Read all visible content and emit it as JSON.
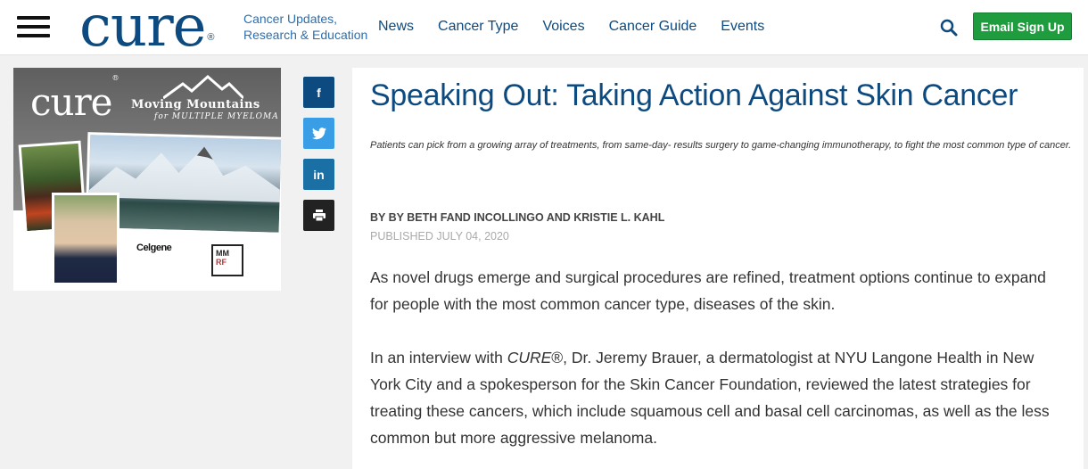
{
  "header": {
    "logo": "cure",
    "logo_mark": "®",
    "tagline_line1": "Cancer Updates,",
    "tagline_line2": "Research & Education",
    "nav": [
      "News",
      "Cancer Type",
      "Voices",
      "Cancer Guide",
      "Events"
    ],
    "signup_label": "Email Sign Up",
    "icons": [
      "hamburger-menu-icon",
      "search-icon"
    ]
  },
  "ad": {
    "logo": "cure",
    "logo_mark": "®",
    "headline": "Moving Mountains",
    "subheadline": "for MULTIPLE MYELOMA",
    "sponsor1": "Celgene",
    "sponsor2_line1": "MM",
    "sponsor2_line2": "RF"
  },
  "social": {
    "facebook": "f",
    "twitter": "t",
    "linkedin": "in",
    "print_icon": "print-icon"
  },
  "article": {
    "title": "Speaking Out: Taking Action Against Skin Cancer",
    "deck": "Patients can pick from a growing array of treatments, from same-day- results surgery to game-changing immunotherapy, to fight the most common type of cancer.",
    "byline": "BY BY BETH FAND INCOLLINGO AND KRISTIE L. KAHL",
    "published": "PUBLISHED JULY 04, 2020",
    "p1": "As novel drugs emerge and surgical procedures are refined, treatment options continue to expand for people with the most common cancer type, diseases of the skin.",
    "p2_before": "In an interview with ",
    "p2_em": "CURE",
    "p2_after": "®, Dr. Jeremy Brauer, a dermatologist at NYU Langone Health in New York City and a spokesperson for the Skin Cancer Foundation, reviewed the latest strategies for treating these cancers, which include squamous cell and basal cell carcinomas, as well as the less common but more aggressive melanoma."
  },
  "colors": {
    "brand_blue": "#0d4a7f",
    "signup_green": "#1f9d3e",
    "twitter_blue": "#3a9ee6"
  }
}
